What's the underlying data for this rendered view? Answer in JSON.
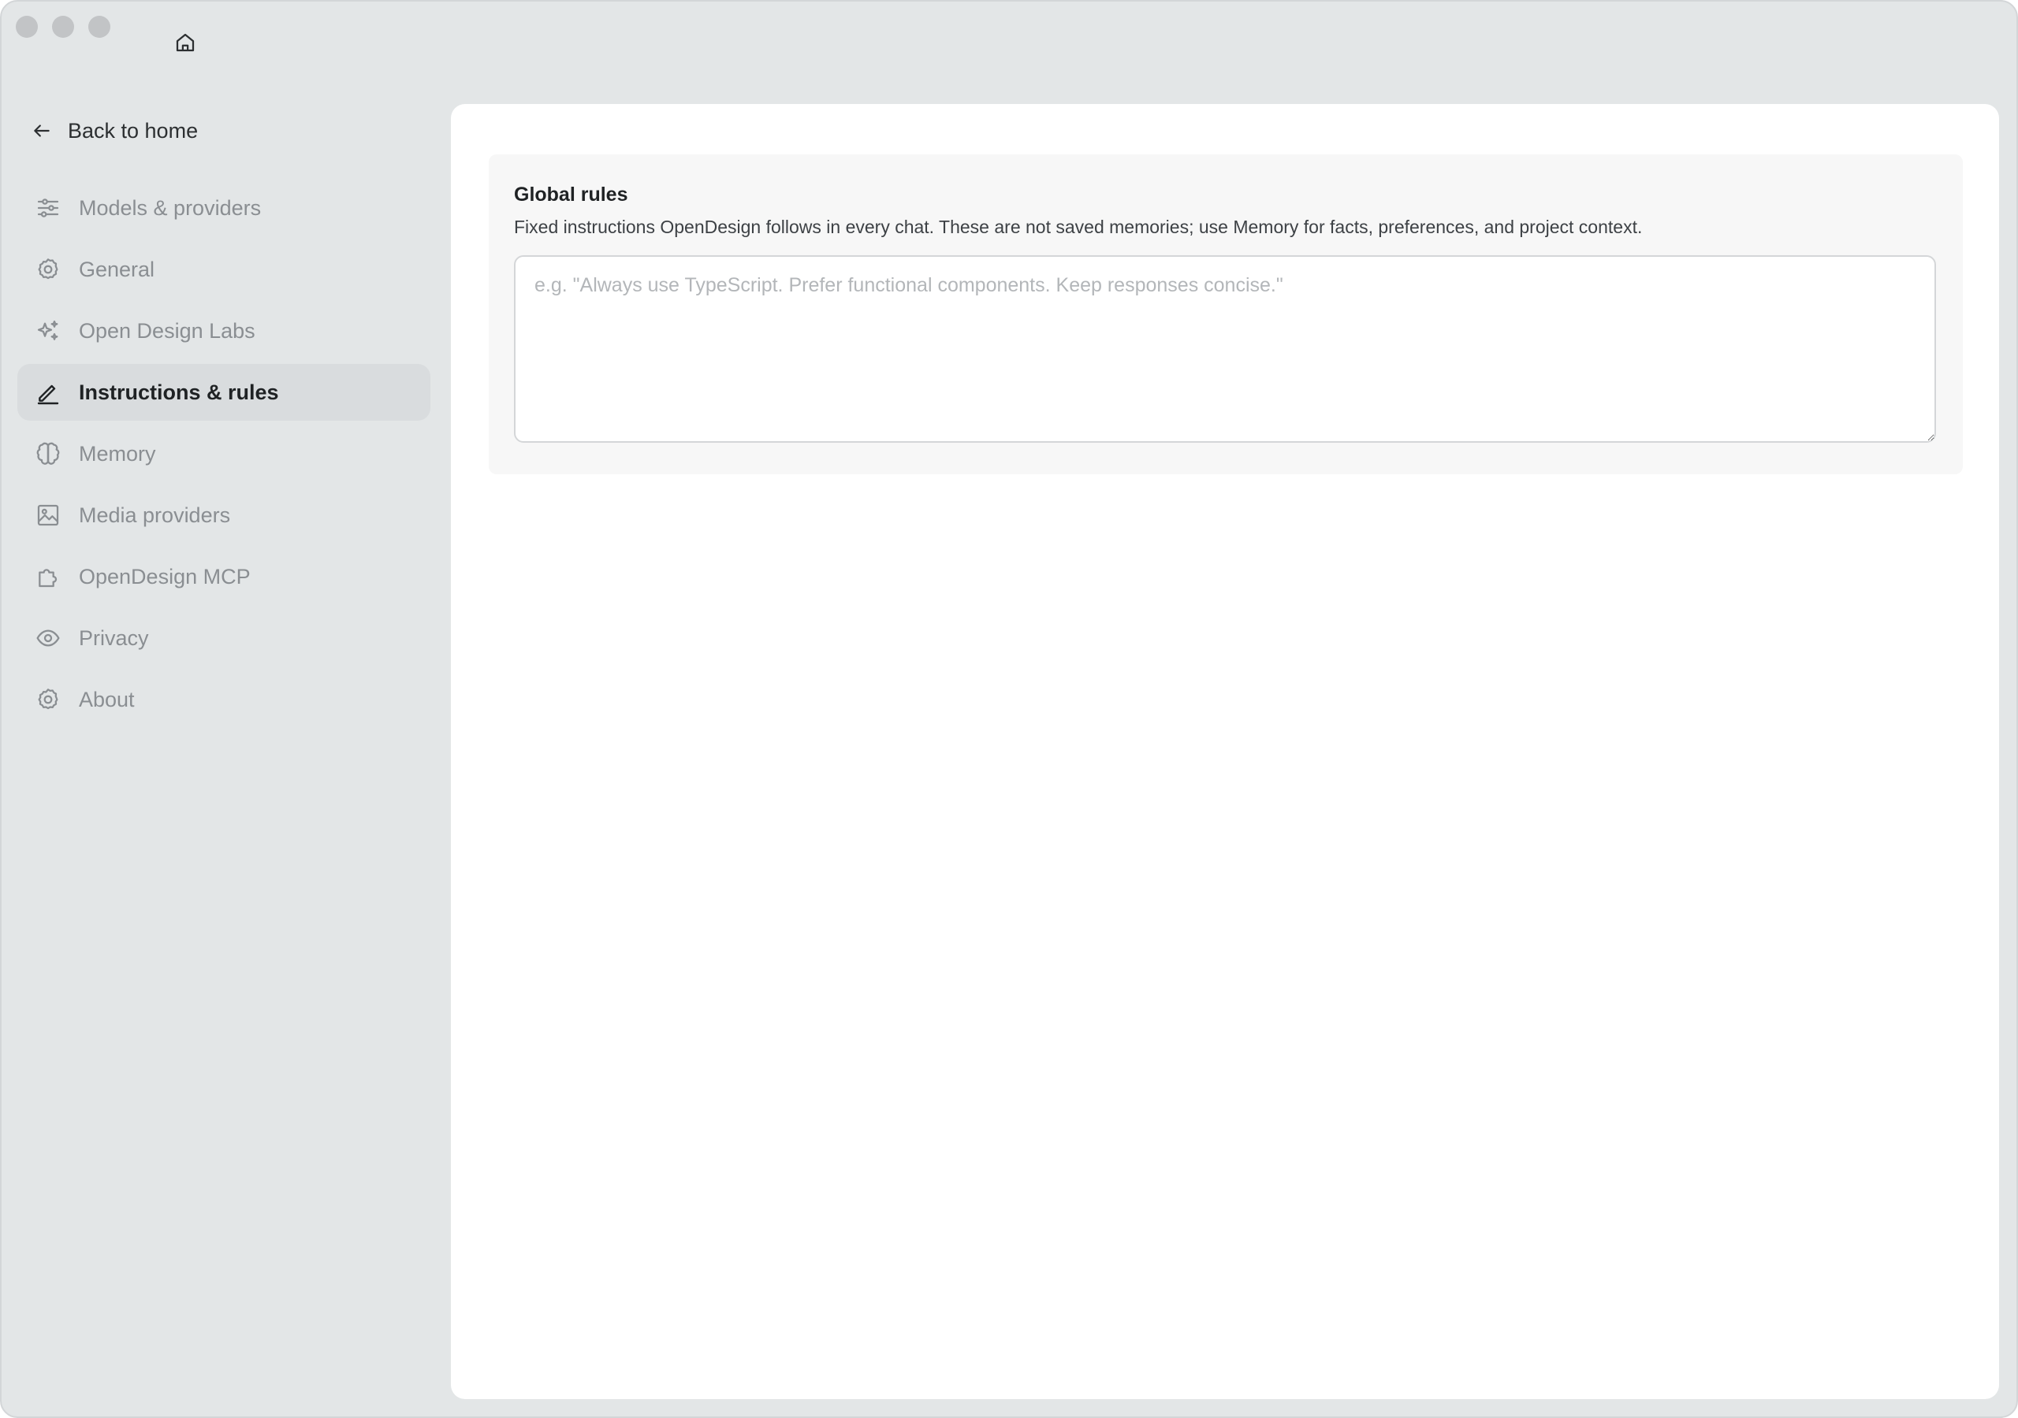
{
  "window": {
    "title": "Instructions & rules"
  },
  "toolbar": {
    "home_icon": "home-icon"
  },
  "sidebar": {
    "back_label": "Back to home",
    "items": [
      {
        "label": "Models & providers",
        "icon": "sliders-icon",
        "active": false
      },
      {
        "label": "General",
        "icon": "gear-icon",
        "active": false
      },
      {
        "label": "Open Design Labs",
        "icon": "sparkles-icon",
        "active": false
      },
      {
        "label": "Instructions & rules",
        "icon": "pencil-icon",
        "active": true
      },
      {
        "label": "Memory",
        "icon": "brain-icon",
        "active": false
      },
      {
        "label": "Media providers",
        "icon": "image-icon",
        "active": false
      },
      {
        "label": "OpenDesign MCP",
        "icon": "puzzle-icon",
        "active": false
      },
      {
        "label": "Privacy",
        "icon": "eye-icon",
        "active": false
      },
      {
        "label": "About",
        "icon": "gear-icon",
        "active": false
      }
    ]
  },
  "main": {
    "section": {
      "title": "Global rules",
      "description": "Fixed instructions OpenDesign follows in every chat. These are not saved memories; use Memory for facts, preferences, and project context.",
      "input": {
        "value": "",
        "placeholder": "e.g. \"Always use TypeScript. Prefer functional components. Keep responses concise.\""
      }
    }
  },
  "colors": {
    "window_bg": "#e3e6e7",
    "panel_bg": "#ffffff",
    "card_bg": "#f7f7f7",
    "active_item_bg": "#d9dcde",
    "text_primary": "#1f2224",
    "text_muted": "#8a8e92"
  }
}
